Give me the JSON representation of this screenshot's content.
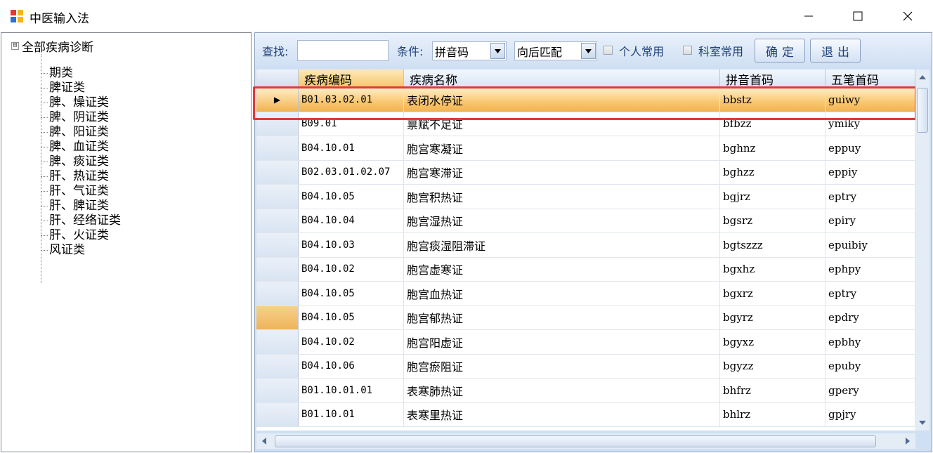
{
  "window": {
    "title": "中医输入法",
    "icons": {
      "app": "app-grid-icon",
      "minimize": "minimize-icon",
      "maximize": "maximize-icon",
      "close": "close-icon"
    }
  },
  "tree": {
    "expander": "⊟",
    "root_label": "全部疾病诊断",
    "items": [
      "期类",
      "脾证类",
      "脾、燥证类",
      "脾、阴证类",
      "脾、阳证类",
      "脾、血证类",
      "脾、痰证类",
      "肝、热证类",
      "肝、气证类",
      "肝、脾证类",
      "肝、经络证类",
      "肝、火证类",
      "风证类"
    ]
  },
  "toolbar": {
    "search_label": "查找:",
    "search_value": "",
    "condition_label": "条件:",
    "condition_value": "拼音码",
    "match_value": "向后匹配",
    "personal_label": "个人常用",
    "dept_label": "科室常用",
    "ok_label": "确定",
    "exit_label": "退出"
  },
  "grid": {
    "columns": [
      "疾病编码",
      "疾病名称",
      "拼音首码",
      "五笔首码"
    ],
    "rows": [
      {
        "code": "B01.03.02.01",
        "name": "表闭水停证",
        "py": "bbstz",
        "wb": "guiwy",
        "marker": "▶"
      },
      {
        "code": "B09.01",
        "name": "禀赋不足证",
        "py": "bfbzz",
        "wb": "ymiky",
        "marker": ""
      },
      {
        "code": "B04.10.01",
        "name": "胞宫寒凝证",
        "py": "bghnz",
        "wb": "eppuy",
        "marker": ""
      },
      {
        "code": "B02.03.01.02.07",
        "name": "胞宫寒滞证",
        "py": "bghzz",
        "wb": "eppiy",
        "marker": ""
      },
      {
        "code": "B04.10.05",
        "name": "胞宫积热证",
        "py": "bgjrz",
        "wb": "eptry",
        "marker": ""
      },
      {
        "code": "B04.10.04",
        "name": "胞宫湿热证",
        "py": "bgsrz",
        "wb": "epiry",
        "marker": ""
      },
      {
        "code": "B04.10.03",
        "name": "胞宫痰湿阻滞证",
        "py": "bgtszzz",
        "wb": "epuibiy",
        "marker": ""
      },
      {
        "code": "B04.10.02",
        "name": "胞宫虚寒证",
        "py": "bgxhz",
        "wb": "ephpy",
        "marker": ""
      },
      {
        "code": "B04.10.05",
        "name": "胞宫血热证",
        "py": "bgxrz",
        "wb": "eptry",
        "marker": ""
      },
      {
        "code": "B04.10.05",
        "name": "胞宫郁热证",
        "py": "bgyrz",
        "wb": "epdry",
        "marker": ""
      },
      {
        "code": "B04.10.02",
        "name": "胞宫阳虚证",
        "py": "bgyxz",
        "wb": "epbhy",
        "marker": ""
      },
      {
        "code": "B04.10.06",
        "name": "胞宫瘀阻证",
        "py": "bgyzz",
        "wb": "epuby",
        "marker": ""
      },
      {
        "code": "B01.10.01.01",
        "name": "表寒肺热证",
        "py": "bhfrz",
        "wb": "gpery",
        "marker": ""
      },
      {
        "code": "B01.10.01",
        "name": "表寒里热证",
        "py": "bhlrz",
        "wb": "gpjry",
        "marker": ""
      }
    ]
  },
  "colors": {
    "selection": "#f8c770",
    "outline": "#e03a3a",
    "header": "#d7e4f4"
  }
}
